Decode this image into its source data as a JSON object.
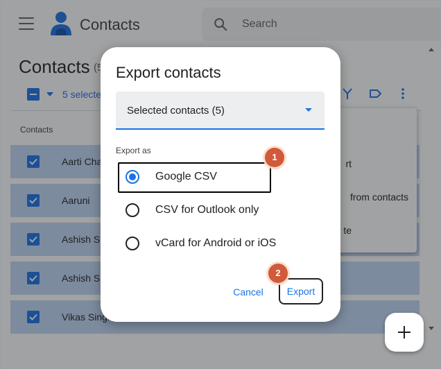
{
  "app": {
    "name": "Contacts",
    "search_placeholder": "Search",
    "page_title": "Contacts",
    "page_count_fragment": "(5",
    "selected_text_fragment": "5 selecte",
    "column_header": "Contacts"
  },
  "rows": [
    {
      "name": "Aarti Cha",
      "checked": true
    },
    {
      "name": "Aaruni",
      "checked": true
    },
    {
      "name": "Ashish Sh",
      "checked": true
    },
    {
      "name": "Ashish Si",
      "checked": true
    },
    {
      "name": "Vikas Singh",
      "checked": true
    }
  ],
  "menu": {
    "items": [
      {
        "text": "rt"
      },
      {
        "text": "from contacts"
      },
      {
        "text": "te"
      }
    ]
  },
  "dialog": {
    "title": "Export contacts",
    "select_value": "Selected contacts (5)",
    "section_label": "Export as",
    "options": [
      {
        "label": "Google CSV",
        "selected": true
      },
      {
        "label": "CSV for Outlook only",
        "selected": false
      },
      {
        "label": "vCard for Android or iOS",
        "selected": false
      }
    ],
    "cancel_label": "Cancel",
    "export_label": "Export"
  },
  "annotations": {
    "step1": "1",
    "step2": "2"
  },
  "colors": {
    "accent": "#1a73e8",
    "row_selected": "#c2d7f6",
    "badge": "#d05a3a"
  },
  "icons": [
    "menu-icon",
    "contacts-logo-icon",
    "search-icon",
    "merge-icon",
    "label-icon",
    "more-vert-icon",
    "add-icon",
    "dropdown-caret-icon"
  ]
}
